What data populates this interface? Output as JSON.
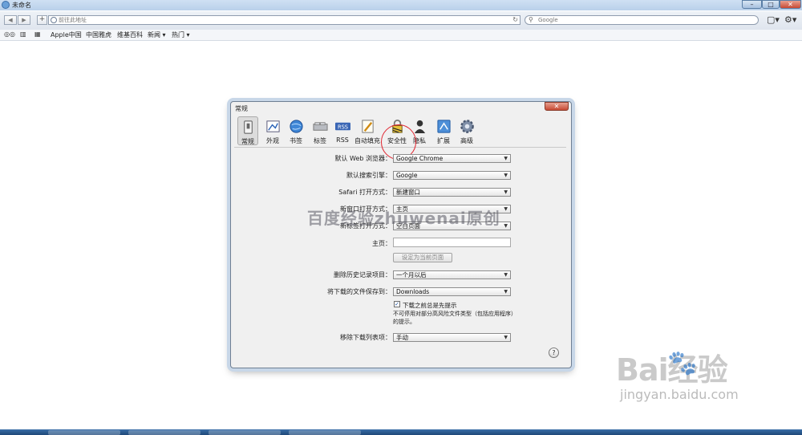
{
  "window": {
    "title": "未命名",
    "min": "–",
    "max": "□",
    "close": "✕"
  },
  "toolbar": {
    "back": "◀",
    "forward": "▶",
    "add": "+",
    "address_placeholder": "前往此地址",
    "reload": "↻",
    "search_placeholder": "Google",
    "search_icon": "⚲",
    "page_menu": "▢▾",
    "settings_menu": "⚙▾"
  },
  "bookmarks": {
    "reading_list": "◎◎",
    "show_bookmarks": "▥",
    "top_sites": "▦",
    "items": [
      "Apple中国",
      "中国雅虎",
      "维基百科",
      "新闻 ▾",
      "热门 ▾"
    ]
  },
  "dialog": {
    "title": "常规",
    "close": "✕",
    "tabs": [
      {
        "label": "常规",
        "icon": "general-switch-icon"
      },
      {
        "label": "外观",
        "icon": "appearance-icon"
      },
      {
        "label": "书签",
        "icon": "bookmarks-globe-icon"
      },
      {
        "label": "标签",
        "icon": "tabs-icon"
      },
      {
        "label": "RSS",
        "icon": "rss-icon"
      },
      {
        "label": "自动填充",
        "icon": "autofill-pencil-icon"
      },
      {
        "label": "安全性",
        "icon": "lock-icon"
      },
      {
        "label": "隐私",
        "icon": "privacy-person-icon"
      },
      {
        "label": "扩展",
        "icon": "extensions-icon"
      },
      {
        "label": "高级",
        "icon": "gear-icon"
      }
    ],
    "rows": {
      "default_browser_label": "默认 Web 浏览器：",
      "default_browser_value": "Google Chrome",
      "search_engine_label": "默认搜索引擎：",
      "search_engine_value": "Google",
      "safari_opens_label": "Safari 打开方式：",
      "safari_opens_value": "新建窗口",
      "new_window_label": "新窗口打开方式：",
      "new_window_value": "主页",
      "new_tab_label": "新标签打开方式：",
      "new_tab_value": "空白页面",
      "homepage_label": "主页：",
      "homepage_value": "",
      "set_current_button": "设定为当前页面",
      "remove_history_label": "删除历史记录项目：",
      "remove_history_value": "一个月以后",
      "save_downloads_label": "将下载的文件保存到：",
      "save_downloads_value": "Downloads",
      "prompt_checkbox_label": "下载之前总是先提示",
      "prompt_checkbox_checked": "✓",
      "prompt_note": "不可停用对部分高风险文件类型（包括应用程序）的提示。",
      "remove_downloads_label": "移除下载列表项：",
      "remove_downloads_value": "手动"
    },
    "help": "?"
  },
  "watermarks": {
    "center": "百度经验zhuwenai原创",
    "logo": "Bai经验",
    "paw": "🐾",
    "site": "jingyan.baidu.com"
  },
  "colors": {
    "annotation_circle": "#e0232e",
    "window_close": "#c74a34"
  }
}
